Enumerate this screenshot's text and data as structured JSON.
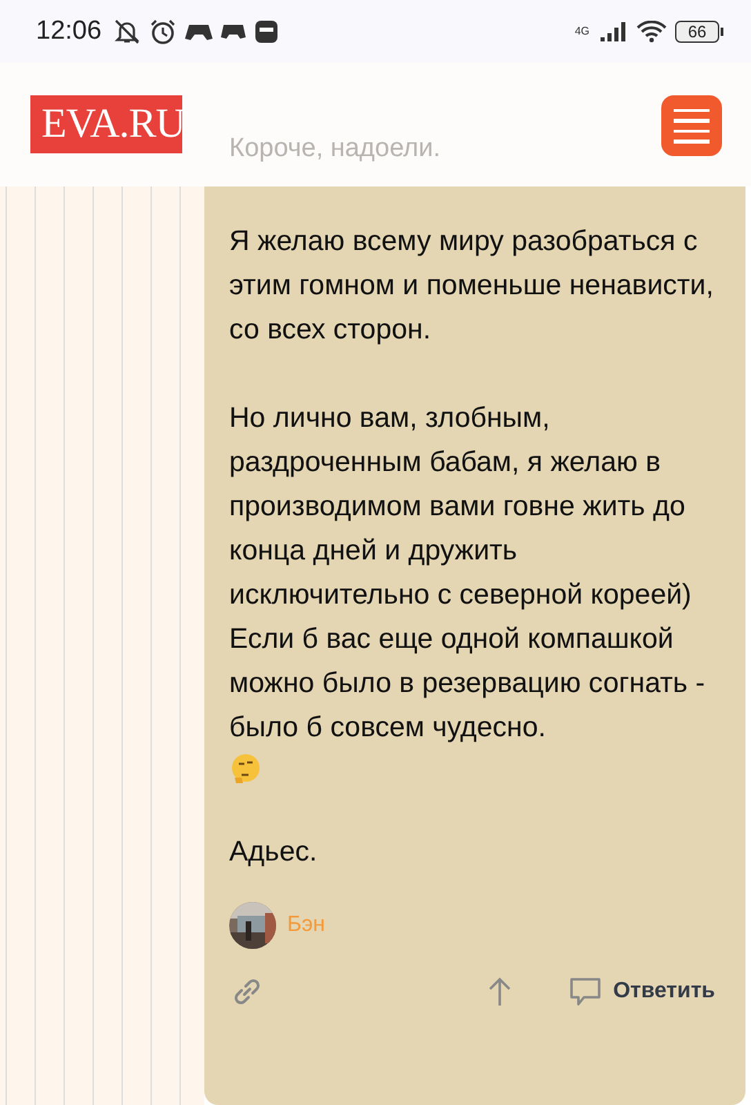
{
  "status_bar": {
    "time": "12:06",
    "network": "4G",
    "battery": "66"
  },
  "header": {
    "logo": "EVA.RU",
    "faded_text": "Короче, надоели."
  },
  "post": {
    "paragraphs": [
      {
        "lines": [
          "Я желаю всему миру разобраться с этим гомном и поменьше ненависти, со всех сторон."
        ]
      },
      {
        "lines": [
          "Но лично вам, злобным, раздроченным бабам, я желаю в производимом вами говне жить до конца дней и дружить исключительно с северной кореей)",
          "Если б вас еще одной компашкой можно было в резервацию согнать - было б совсем чудесно."
        ],
        "emoji": true
      },
      {
        "lines": [
          "Адьес."
        ]
      }
    ],
    "author": "Бэн",
    "reply_label": "Ответить"
  }
}
